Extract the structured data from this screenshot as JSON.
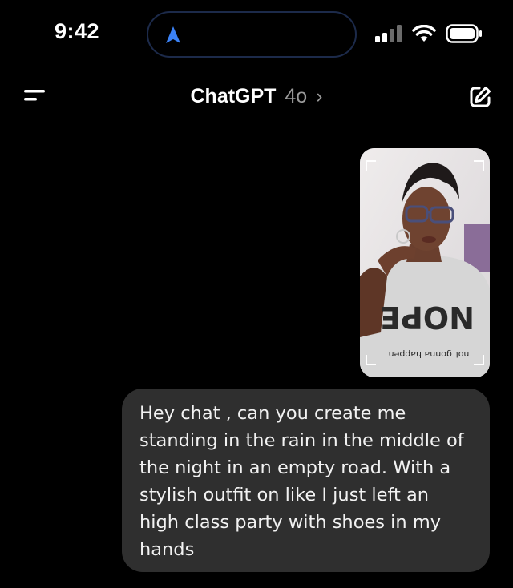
{
  "status_bar": {
    "time": "9:42",
    "icons": [
      "location-arrow-icon",
      "cellular-signal-icon",
      "wifi-icon",
      "battery-icon"
    ]
  },
  "header": {
    "title": "ChatGPT",
    "model": "4o",
    "chevron": "›",
    "menu_icon": "menu-icon",
    "new_chat_icon": "new-chat-icon"
  },
  "conversation": {
    "attachment": {
      "type": "photo",
      "shirt_text": "NOPE",
      "shirt_subtext": "not gonna happen"
    },
    "user_message": "Hey chat , can you create me standing in the rain in the middle of the night in an empty road. With a stylish outfit on like I just left an high class party with shoes in my hands"
  },
  "colors": {
    "background": "#000000",
    "bubble": "#2f2f2f",
    "accent_blue": "#3b82f6",
    "muted_text": "#9a9a9a"
  }
}
